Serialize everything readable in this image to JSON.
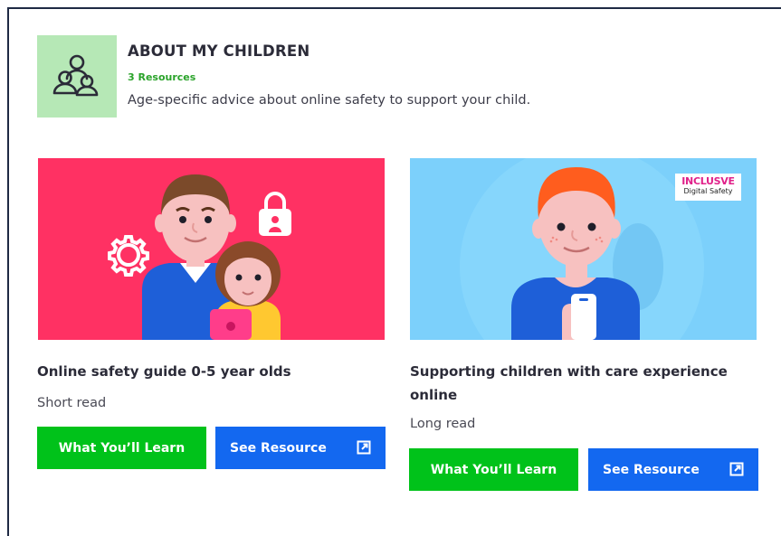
{
  "category": {
    "title": "ABOUT MY CHILDREN",
    "count": "3 Resources",
    "description": "Age-specific advice about online safety to support your child.",
    "icon": "children-group-icon",
    "icon_bg": "#b6e8b6"
  },
  "cards": [
    {
      "title": "Online safety guide 0-5 year olds",
      "read_time": "Short read",
      "learn_label": "What You’ll Learn",
      "resource_label": "See Resource",
      "image_bg": "#ff3163"
    },
    {
      "title": "Supporting children with care experience online",
      "read_time": "Long read",
      "learn_label": "What You’ll Learn",
      "resource_label": "See Resource",
      "image_bg": "#7cd0fb",
      "badge_brand": "INCLUSVE",
      "badge_sub": "Digital Safety"
    }
  ],
  "colors": {
    "green_button": "#00c21a",
    "blue_button": "#1368f0",
    "count_text": "#2aa32a"
  }
}
